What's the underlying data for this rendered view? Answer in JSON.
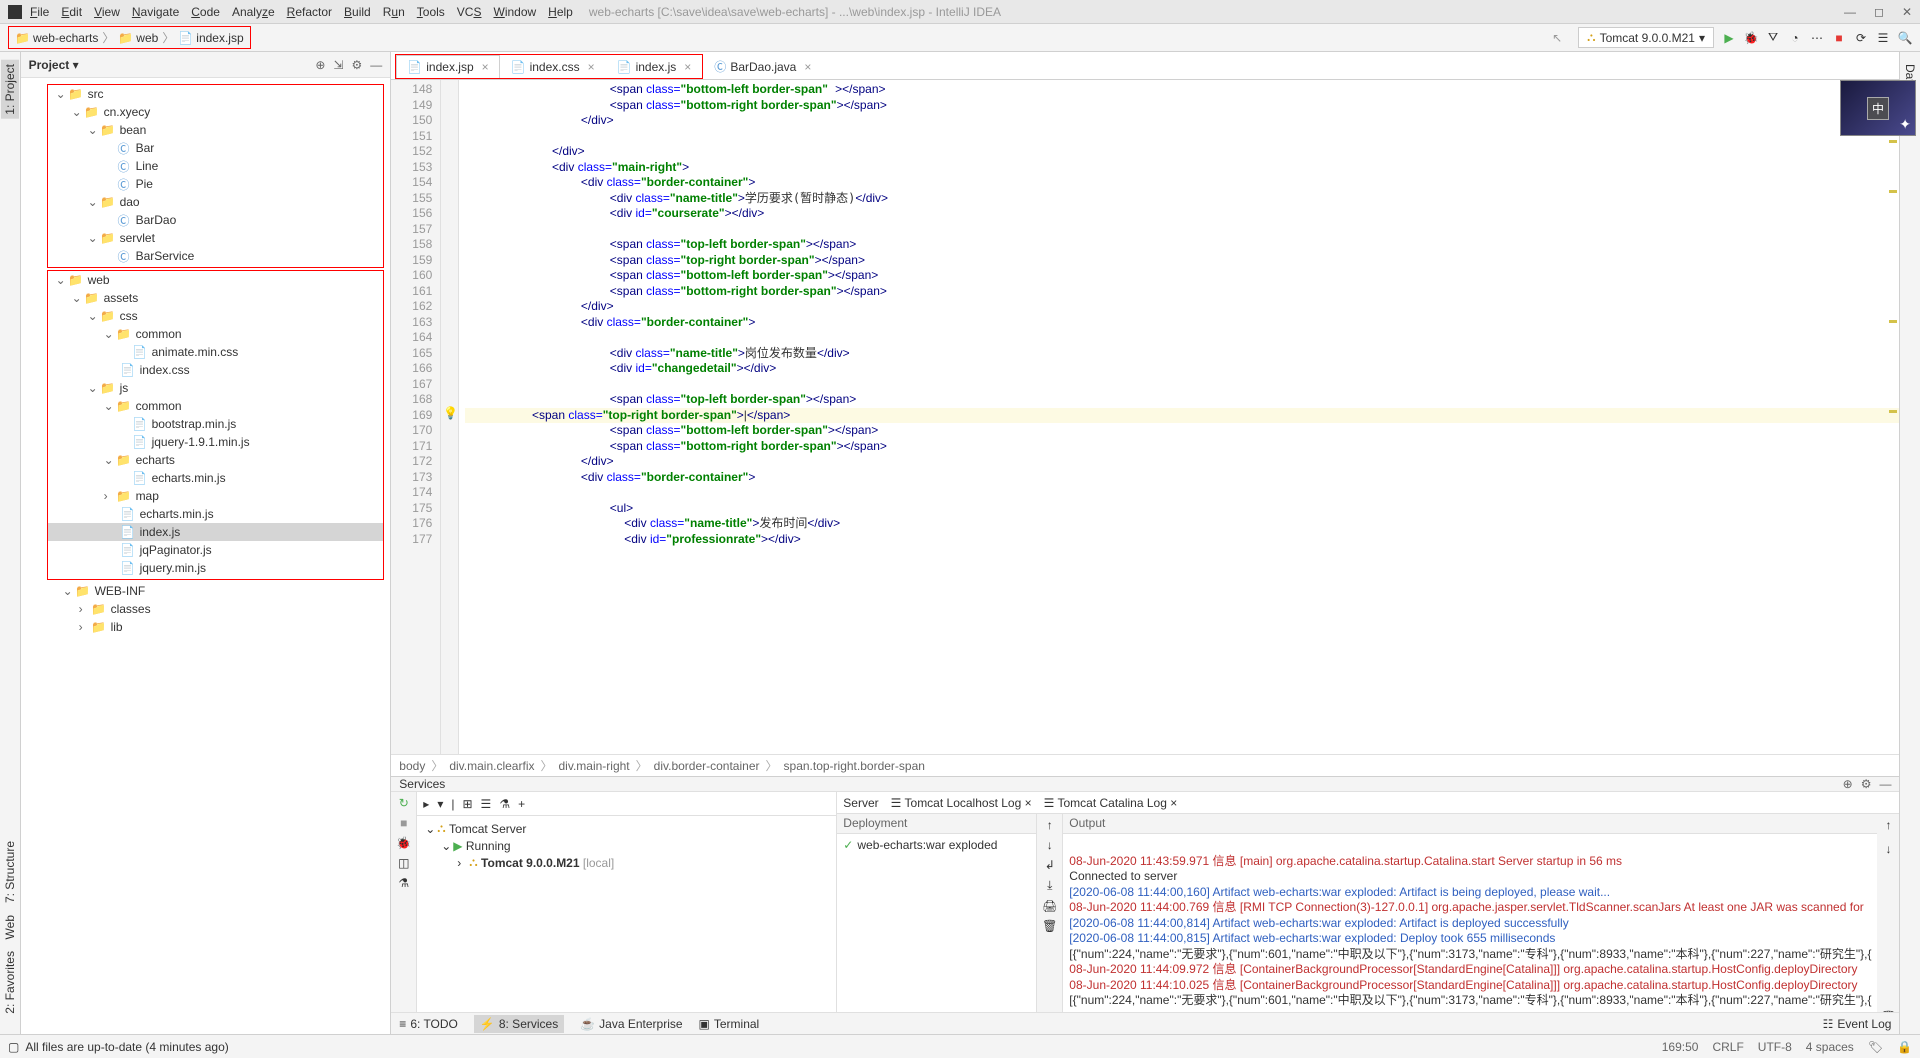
{
  "title_path": "web-echarts [C:\\save\\idea\\save\\web-echarts] - ...\\web\\index.jsp - IntelliJ IDEA",
  "menu": [
    "File",
    "Edit",
    "View",
    "Navigate",
    "Code",
    "Analyze",
    "Refactor",
    "Build",
    "Run",
    "Tools",
    "VCS",
    "Window",
    "Help"
  ],
  "breadcrumb": [
    "web-echarts",
    "web",
    "index.jsp"
  ],
  "run_config": "Tomcat 9.0.0.M21",
  "project_panel_title": "Project",
  "tree": {
    "n1": "src",
    "n2": "cn.xyecy",
    "n3": "bean",
    "n4": "Bar",
    "n5": "Line",
    "n6": "Pie",
    "n7": "dao",
    "n8": "BarDao",
    "n9": "servlet",
    "n10": "BarService",
    "n11": "web",
    "n12": "assets",
    "n13": "css",
    "n14": "common",
    "n15": "animate.min.css",
    "n16": "index.css",
    "n17": "js",
    "n18": "common",
    "n19": "bootstrap.min.js",
    "n20": "jquery-1.9.1.min.js",
    "n21": "echarts",
    "n22": "echarts.min.js",
    "n23": "map",
    "n24": "echarts.min.js",
    "n25": "index.js",
    "n26": "jqPaginator.js",
    "n27": "jquery.min.js",
    "n28": "WEB-INF",
    "n29": "classes",
    "n30": "lib"
  },
  "editor_tabs": {
    "t1": "index.jsp",
    "t2": "index.css",
    "t3": "index.js",
    "t4": "BarDao.java"
  },
  "line_numbers": [
    "148",
    "149",
    "150",
    "151",
    "152",
    "153",
    "154",
    "155",
    "156",
    "157",
    "158",
    "159",
    "160",
    "161",
    "162",
    "163",
    "164",
    "165",
    "166",
    "167",
    "168",
    "169",
    "170",
    "171",
    "172",
    "173",
    "174",
    "175",
    "176",
    "177"
  ],
  "code_crumbs": [
    "body",
    "div.main.clearfix",
    "div.main-right",
    "div.border-container",
    "span.top-right.border-span"
  ],
  "code_crumbs_sep": "〉",
  "services": {
    "title": "Services",
    "server_tab": "Server",
    "local_log_tab": "Tomcat Localhost Log",
    "catalina_tab": "Tomcat Catalina Log",
    "deploy_col": "Deployment",
    "output_col": "Output",
    "tree_root": "Tomcat Server",
    "tree_running": "Running",
    "tree_instance": "Tomcat 9.0.0.M21",
    "tree_instance_extra": "[local]",
    "deploy_item": "web-echarts:war exploded",
    "log1": "08-Jun-2020 11:43:59.971 信息 [main] org.apache.catalina.startup.Catalina.start Server startup in 56 ms",
    "log2": "Connected to server",
    "log3": "[2020-06-08 11:44:00,160] Artifact web-echarts:war exploded: Artifact is being deployed, please wait...",
    "log4": "08-Jun-2020 11:44:00.769 信息 [RMI TCP Connection(3)-127.0.0.1] org.apache.jasper.servlet.TldScanner.scanJars At least one JAR was scanned for",
    "log5": "[2020-06-08 11:44:00,814] Artifact web-echarts:war exploded: Artifact is deployed successfully",
    "log6": "[2020-06-08 11:44:00,815] Artifact web-echarts:war exploded: Deploy took 655 milliseconds",
    "log7": "[{\"num\":224,\"name\":\"无要求\"},{\"num\":601,\"name\":\"中职及以下\"},{\"num\":3173,\"name\":\"专科\"},{\"num\":8933,\"name\":\"本科\"},{\"num\":227,\"name\":\"研究生\"},{",
    "log8": "08-Jun-2020 11:44:09.972 信息 [ContainerBackgroundProcessor[StandardEngine[Catalina]]] org.apache.catalina.startup.HostConfig.deployDirectory",
    "log9": "08-Jun-2020 11:44:10.025 信息 [ContainerBackgroundProcessor[StandardEngine[Catalina]]] org.apache.catalina.startup.HostConfig.deployDirectory",
    "log10": "[{\"num\":224,\"name\":\"无要求\"},{\"num\":601,\"name\":\"中职及以下\"},{\"num\":3173,\"name\":\"专科\"},{\"num\":8933,\"name\":\"本科\"},{\"num\":227,\"name\":\"研究生\"},{"
  },
  "bottom_tabs": {
    "todo": "6: TODO",
    "services": "8: Services",
    "jee": "Java Enterprise",
    "term": "Terminal",
    "eventlog": "Event Log"
  },
  "status": {
    "msg": "All files are up-to-date (4 minutes ago)",
    "pos": "169:50",
    "sep": "CRLF",
    "enc": "UTF-8",
    "indent": "4 spaces"
  },
  "left_tabs": {
    "project": "1: Project",
    "structure": "7: Structure",
    "web": "Web",
    "fav": "2: Favorites"
  },
  "right_tabs": {
    "database": "Database"
  },
  "ime_badge": "中"
}
